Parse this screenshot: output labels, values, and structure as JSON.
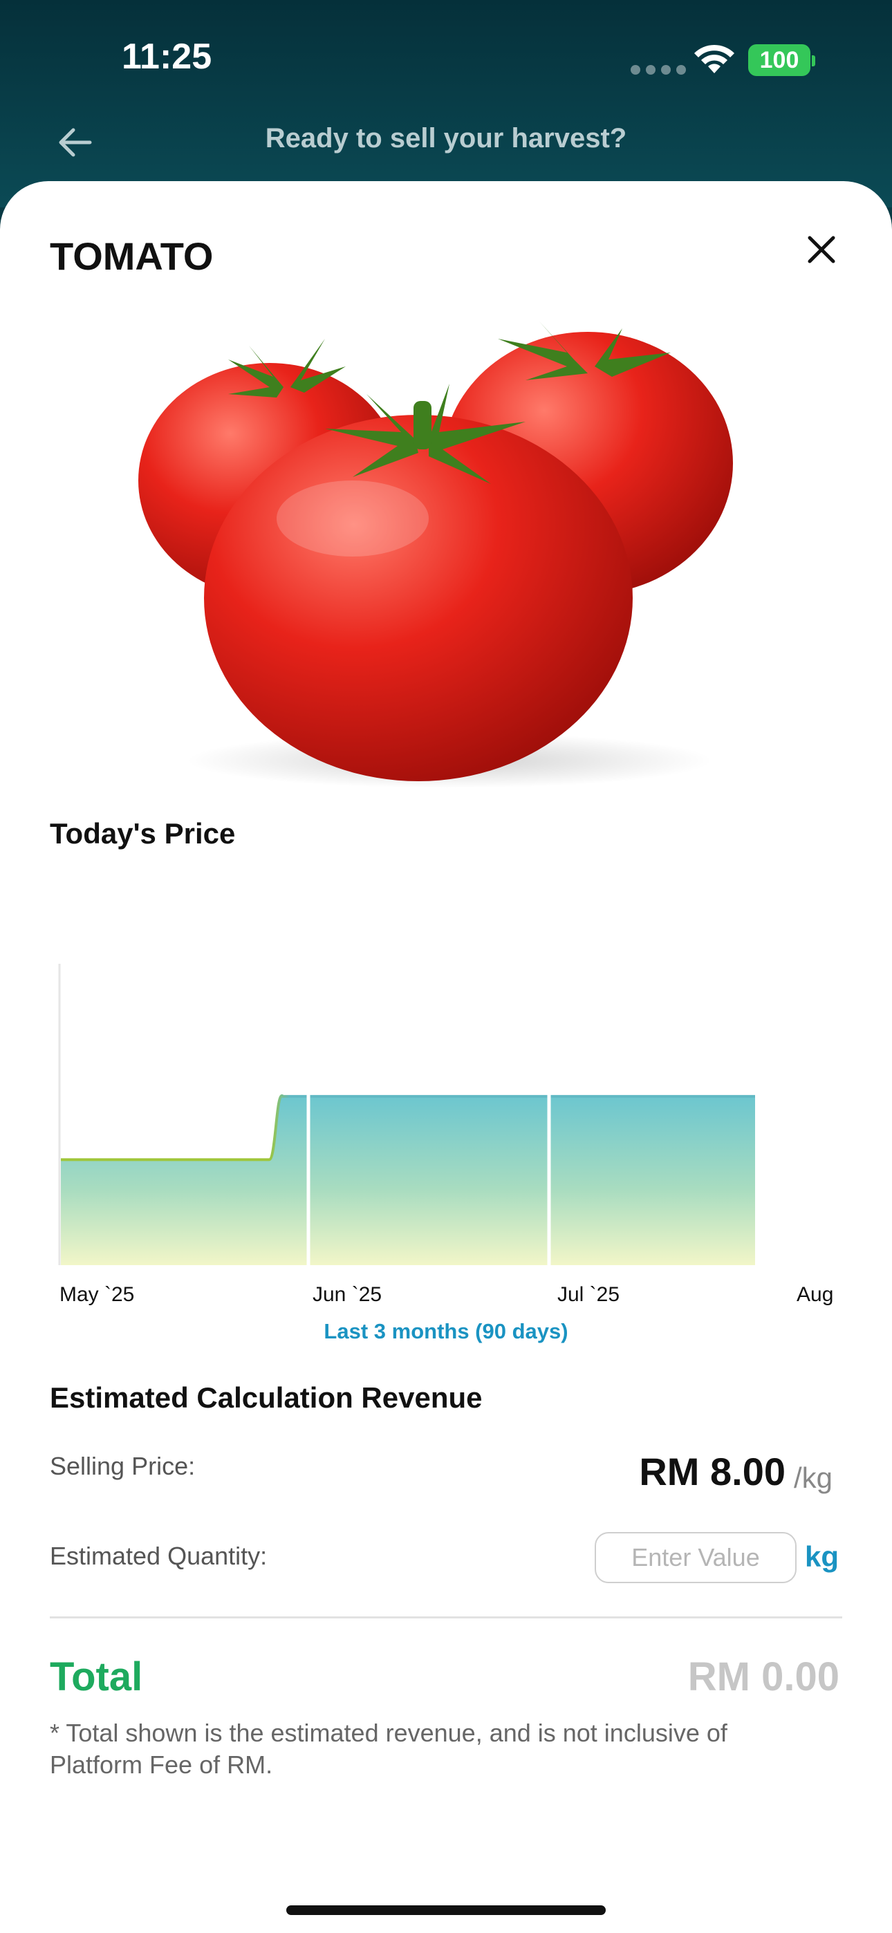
{
  "status_bar": {
    "time": "11:25",
    "battery": "100"
  },
  "header": {
    "title": "Ready to sell your harvest?"
  },
  "product": {
    "name": "TOMATO"
  },
  "price_section": {
    "title": "Today's Price",
    "range_label": "Last 3 months (90 days)"
  },
  "chart_data": {
    "type": "area",
    "x_tick_labels": [
      "May `25",
      "Jun `25",
      "Jul `25",
      "Aug"
    ],
    "series": [
      {
        "points": [
          {
            "t": 0.0,
            "v": 5.0
          },
          {
            "t": 0.3,
            "v": 5.0
          },
          {
            "t": 0.32,
            "v": 8.0
          },
          {
            "t": 1.0,
            "v": 8.0
          }
        ]
      }
    ],
    "ylim": [
      0,
      10
    ],
    "grid": "vertical at month boundaries",
    "colors": {
      "line_low": "#9fc63a",
      "line_high": "#62b9c4",
      "fill_top": "#6cc6cf",
      "fill_bottom": "#f2f6c8"
    }
  },
  "revenue": {
    "title": "Estimated Calculation Revenue",
    "selling_price_label": "Selling Price:",
    "selling_price_value": "RM 8.00",
    "selling_price_unit": "/kg",
    "quantity_label": "Estimated Quantity:",
    "quantity_placeholder": "Enter Value",
    "quantity_unit": "kg",
    "total_label": "Total",
    "total_value": "RM 0.00",
    "footnote": "* Total shown is the estimated revenue, and is not inclusive of Platform Fee of RM."
  },
  "colors": {
    "header_bg": "#083a44",
    "accent_blue": "#1a93c2",
    "total_green": "#1eaa5e"
  }
}
